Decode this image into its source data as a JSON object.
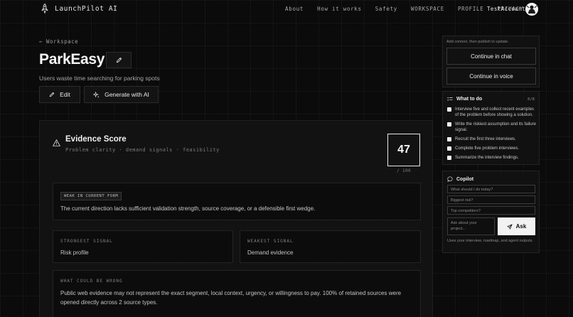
{
  "nav": {
    "brand": "LaunchPilot AI",
    "links": [
      "About",
      "How it works",
      "Safety",
      "WORKSPACE",
      "PROFILE",
      "PRIVACY"
    ],
    "account": "TestAccount"
  },
  "header": {
    "back_label": "← Workspace",
    "title": "ParkEasy",
    "subtitle": "Users waste time searching for parking spots",
    "edit_label": "Edit",
    "generate_label": "Generate with AI"
  },
  "evidence": {
    "title": "Evidence Score",
    "subtitle": "Problem clarity · demand signals · feasibility",
    "score": "47",
    "score_max": "/ 100",
    "status_tag": "WEAK IN CURRENT FORM",
    "status_text": "The current direction lacks sufficient validation strength, source coverage, or a defensible first wedge.",
    "strongest_label": "STRONGEST SIGNAL",
    "strongest_value": "Risk profile",
    "weakest_label": "WEAKEST SIGNAL",
    "weakest_value": "Demand evidence",
    "wrong_label": "WHAT COULD BE WRONG",
    "wrong_text": "Public web evidence may not represent the exact segment, local context, urgency, or willingness to pay. 100% of retained sources were opened directly across 2 source types."
  },
  "continue": {
    "hint": "Add context, then publish to update.",
    "chat_label": "Continue in chat",
    "voice_label": "Continue in voice"
  },
  "todo": {
    "title": "What to do",
    "count": "0/8",
    "items": [
      "Interview five and collect recent examples of the problem before showing a solution.",
      "Write the riskiest assumption and its failure signal.",
      "Recruit the first three interviews.",
      "Complete five problem interviews.",
      "Summarize the interview findings."
    ]
  },
  "copilot": {
    "title": "Copilot",
    "suggestions": [
      "What should I do today?",
      "Biggest risk?",
      "Top competitors?"
    ],
    "ask_placeholder": "Ask about your project...",
    "ask_label": "Ask",
    "note": "Uses your interview, roadmap, and agent outputs."
  },
  "colors": {
    "background": "#0b0b0b",
    "accent": "#f2f2f2",
    "panel": "#141414"
  }
}
